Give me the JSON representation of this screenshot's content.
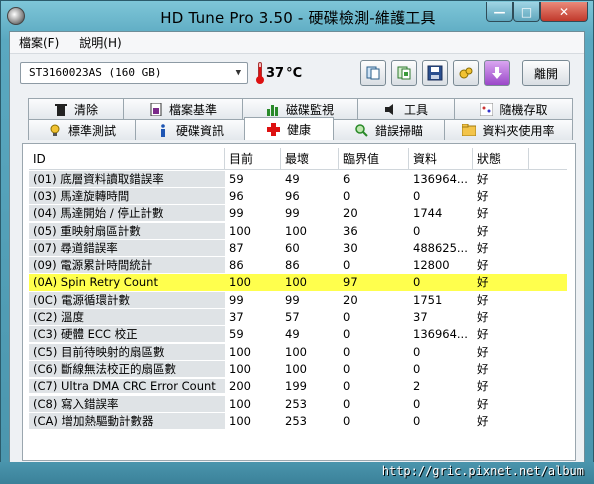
{
  "window": {
    "title": "HD Tune Pro 3.50 - 硬碟檢測-維護工具",
    "minimize_label": "—",
    "maximize_label": "□",
    "close_label": "✕"
  },
  "menu": {
    "file": "檔案(F)",
    "help": "說明(H)"
  },
  "toolbar": {
    "drive": "ST3160023AS (160 GB)",
    "temperature": "37",
    "temperature_unit": "°C",
    "exit_label": "離開"
  },
  "tabs_back": [
    {
      "label": "清除",
      "icon": "trash-icon"
    },
    {
      "label": "檔案基準",
      "icon": "file-benchmark-icon"
    },
    {
      "label": "磁碟監視",
      "icon": "disk-monitor-icon"
    },
    {
      "label": "工具",
      "icon": "speaker-icon"
    },
    {
      "label": "隨機存取",
      "icon": "random-access-icon"
    }
  ],
  "tabs_front": [
    {
      "label": "標準測試",
      "icon": "bulb-icon"
    },
    {
      "label": "硬碟資訊",
      "icon": "info-icon"
    },
    {
      "label": "健康",
      "icon": "red-cross-icon"
    },
    {
      "label": "錯誤掃瞄",
      "icon": "magnifier-icon"
    },
    {
      "label": "資料夾使用率",
      "icon": "folder-icon"
    }
  ],
  "table": {
    "headers": [
      "ID",
      "目前",
      "最壞",
      "臨界值",
      "資料",
      "狀態"
    ],
    "rows": [
      {
        "id": "(01) 底層資料讀取錯誤率",
        "current": "59",
        "worst": "49",
        "threshold": "6",
        "data": "136964...",
        "status": "好"
      },
      {
        "id": "(03) 馬達旋轉時間",
        "current": "96",
        "worst": "96",
        "threshold": "0",
        "data": "0",
        "status": "好"
      },
      {
        "id": "(04) 馬達開始 / 停止計數",
        "current": "99",
        "worst": "99",
        "threshold": "20",
        "data": "1744",
        "status": "好"
      },
      {
        "id": "(05) 重映射扇區計數",
        "current": "100",
        "worst": "100",
        "threshold": "36",
        "data": "0",
        "status": "好"
      },
      {
        "id": "(07) 尋道錯誤率",
        "current": "87",
        "worst": "60",
        "threshold": "30",
        "data": "488625...",
        "status": "好"
      },
      {
        "id": "(09) 電源累計時間統計",
        "current": "86",
        "worst": "86",
        "threshold": "0",
        "data": "12800",
        "status": "好"
      },
      {
        "id": "(0A) Spin Retry Count",
        "current": "100",
        "worst": "100",
        "threshold": "97",
        "data": "0",
        "status": "好",
        "highlight": true
      },
      {
        "id": "(0C) 電源循環計數",
        "current": "99",
        "worst": "99",
        "threshold": "20",
        "data": "1751",
        "status": "好"
      },
      {
        "id": "(C2) 溫度",
        "current": "37",
        "worst": "57",
        "threshold": "0",
        "data": "37",
        "status": "好"
      },
      {
        "id": "(C3) 硬體 ECC 校正",
        "current": "59",
        "worst": "49",
        "threshold": "0",
        "data": "136964...",
        "status": "好"
      },
      {
        "id": "(C5) 目前待映射的扇區數",
        "current": "100",
        "worst": "100",
        "threshold": "0",
        "data": "0",
        "status": "好"
      },
      {
        "id": "(C6) 斷線無法校正的扇區數",
        "current": "100",
        "worst": "100",
        "threshold": "0",
        "data": "0",
        "status": "好"
      },
      {
        "id": "(C7) Ultra DMA CRC Error Count",
        "current": "200",
        "worst": "199",
        "threshold": "0",
        "data": "2",
        "status": "好"
      },
      {
        "id": "(C8) 寫入錯誤率",
        "current": "100",
        "worst": "253",
        "threshold": "0",
        "data": "0",
        "status": "好"
      },
      {
        "id": "(CA) 增加熱驅動計數器",
        "current": "100",
        "worst": "253",
        "threshold": "0",
        "data": "0",
        "status": "好"
      }
    ]
  },
  "watermark": "http://gric.pixnet.net/album",
  "colors": {
    "highlight": "#ffff4d",
    "frame": "#4a95ad",
    "close": "#c1392b"
  }
}
